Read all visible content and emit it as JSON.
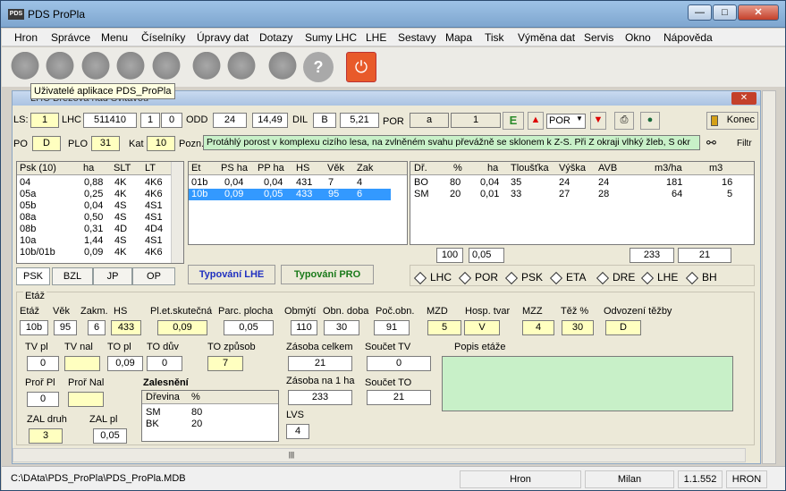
{
  "app": {
    "title": "PDS ProPla",
    "icon_text": "PDS"
  },
  "window_buttons": {
    "minimize": "—",
    "maximize": "□",
    "close": "✕"
  },
  "menu": [
    "Hron",
    "Správce",
    "Menu",
    "Číselníky",
    "Úpravy dat",
    "Dotazy",
    "Sumy LHC",
    "LHE",
    "Sestavy",
    "Mapa",
    "Tisk",
    "Výměna dat",
    "Servis",
    "Okno",
    "Nápověda"
  ],
  "toolbar": {
    "icons": [
      "users-icon",
      "person-icon",
      "chat-icon",
      "group-icon",
      "settings-icon",
      "globe-icon",
      "search-icon",
      "book-icon",
      "help-icon",
      "power-icon"
    ],
    "help_label": "?",
    "power_label": "⏻"
  },
  "tooltip": "Uživatelé aplikace PDS_ProPla",
  "child": {
    "title": "LHC Březová nad Svitavou",
    "close": "✕"
  },
  "row1": {
    "ls_label": "LS:",
    "ls": "1",
    "lhc_label": "LHC",
    "lhc": "511410",
    "f1": "1",
    "f2": "0",
    "odd_label": "ODD",
    "odd": "24",
    "area": "14,49",
    "dil_label": "DIL",
    "dil": "B",
    "dil_val": "5,21",
    "por_label": "POR",
    "por": "a",
    "por_num": "1",
    "e": "E",
    "por_sel": "POR",
    "konec": "Konec"
  },
  "row2": {
    "po_label": "PO",
    "po": "D",
    "plo_label": "PLO",
    "plo": "31",
    "kat_label": "Kat",
    "kat": "10",
    "pozn_label": "Pozn.",
    "pozn": "Protáhlý porost v komplexu cizího lesa, na zvlněném svahu převážně se sklonem k Z-S. Při Z okraji vlhký žleb, S okr",
    "filtr": "Filtr"
  },
  "psk_grid": {
    "headers": [
      "Psk (10)",
      "ha",
      "SLT",
      "LT"
    ],
    "rows": [
      [
        "04",
        "0,88",
        "4K",
        "4K6"
      ],
      [
        "05a",
        "0,25",
        "4K",
        "4K6"
      ],
      [
        "05b",
        "0,04",
        "4S",
        "4S1"
      ],
      [
        "08a",
        "0,50",
        "4S",
        "4S1"
      ],
      [
        "08b",
        "0,31",
        "4D",
        "4D4"
      ],
      [
        "10a",
        "1,44",
        "4S",
        "4S1"
      ],
      [
        "10b/01b",
        "0,09",
        "4K",
        "4K6"
      ]
    ]
  },
  "et_grid": {
    "headers": [
      "Et",
      "PS ha",
      "PP ha",
      "HS",
      "Věk",
      "Zak"
    ],
    "rows": [
      [
        "01b",
        "0,04",
        "0,04",
        "431",
        "7",
        "4"
      ],
      [
        "10b",
        "0,09",
        "0,05",
        "433",
        "95",
        "6"
      ]
    ]
  },
  "dr_grid": {
    "headers": [
      "Dř.",
      "%",
      "ha",
      "Tloušťka",
      "Výška",
      "AVB",
      "m3/ha",
      "m3"
    ],
    "rows": [
      [
        "BO",
        "80",
        "0,04",
        "35",
        "24",
        "24",
        "181",
        "16"
      ],
      [
        "SM",
        "20",
        "0,01",
        "33",
        "27",
        "28",
        "64",
        "5"
      ]
    ],
    "totals": [
      "100",
      "0,05",
      "233",
      "21"
    ]
  },
  "tabs": [
    "PSK",
    "BZL",
    "JP",
    "OP"
  ],
  "typ_lhe": "Typování LHE",
  "typ_pro": "Typování PRO",
  "radio_opts": [
    "LHC",
    "POR",
    "PSK",
    "ETA",
    "DRE",
    "LHE",
    "BH"
  ],
  "etaz": {
    "legend": "Etáž",
    "labels": {
      "etaz": "Etáž",
      "vek": "Věk",
      "zakm": "Zakm.",
      "hs": "HS",
      "plet": "Pl.et.skutečná",
      "parc": "Parc. plocha",
      "obmyti": "Obmýtí",
      "obn": "Obn. doba",
      "pocobn": "Poč.obn.",
      "mzd": "MZD",
      "hosp": "Hosp. tvar",
      "mzz": "MZZ",
      "tez": "Těž %",
      "odv": "Odvození těžby"
    },
    "values": {
      "etaz": "10b",
      "vek": "95",
      "zakm": "6",
      "hs": "433",
      "plet": "0,09",
      "parc": "0,05",
      "obmyti": "110",
      "obn": "30",
      "pocobn": "91",
      "mzd": "5",
      "hosp": "V",
      "mzz": "4",
      "tez": "30",
      "odv": "D"
    },
    "tv_pl_label": "TV pl",
    "tv_pl": "0",
    "tv_nal_label": "TV nal",
    "tv_nal": "",
    "to_pl_label": "TO pl",
    "to_pl": "0,09",
    "to_duv_label": "TO dův",
    "to_duv": "0",
    "to_zp_label": "TO způsob",
    "to_zp": "7",
    "zas_celk_label": "Zásoba celkem",
    "zas_celk": "21",
    "soucet_tv_label": "Součet TV",
    "soucet_tv": "0",
    "zas_ha_label": "Zásoba na 1 ha",
    "zas_ha": "233",
    "soucet_to_label": "Součet TO",
    "soucet_to": "21",
    "popis_label": "Popis etáže",
    "prof_pl_label": "Proř Pl",
    "prof_pl": "0",
    "prof_nal_label": "Proř Nal",
    "prof_nal": "",
    "zal_druh_label": "ZAL druh",
    "zal_druh": "3",
    "zal_pl_label": "ZAL pl",
    "zal_pl": "0,05",
    "lvs_label": "LVS",
    "lvs": "4",
    "zales_label": "Zalesnění",
    "zales_headers": [
      "Dřevina",
      "%"
    ],
    "zales_rows": [
      [
        "SM",
        "80"
      ],
      [
        "BK",
        "20"
      ]
    ]
  },
  "status": {
    "path": "C:\\DAta\\PDS_ProPla\\PDS_ProPla.MDB",
    "hron": "Hron",
    "user": "Milan",
    "version": "1.1.552",
    "code": "HRON"
  },
  "hscroll_grip": "|||"
}
